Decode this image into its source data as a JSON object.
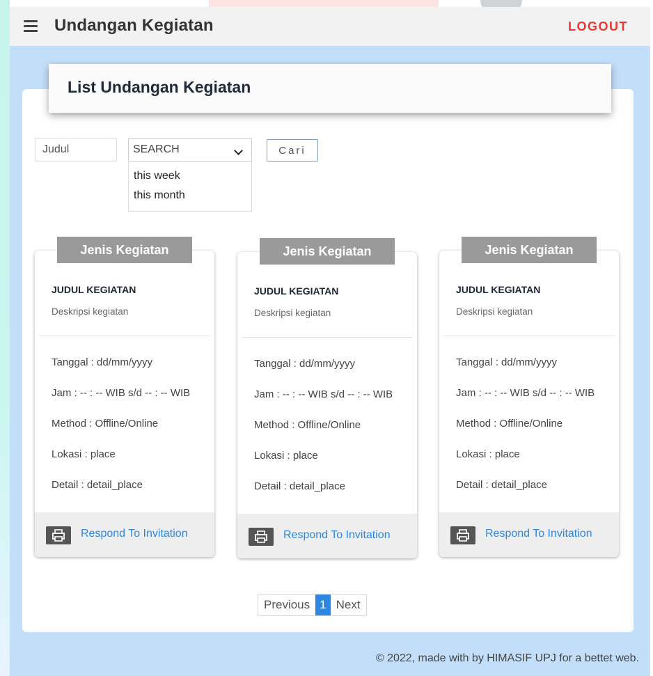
{
  "header": {
    "title": "Undangan Kegiatan",
    "logout_label": "LOGOUT"
  },
  "page": {
    "heading": "List Undangan Kegiatan"
  },
  "filters": {
    "judul_value": "Judul",
    "select_value": "SEARCH",
    "options": [
      "this week",
      "this month"
    ],
    "search_button": "Cari"
  },
  "cards": [
    {
      "tag": "Jenis Kegiatan",
      "title": "JUDUL KEGIATAN",
      "description": "Deskripsi kegiatan",
      "tanggal": "Tanggal : dd/mm/yyyy",
      "jam": "Jam : -- : -- WIB s/d -- : -- WIB",
      "method": "Method : Offline/Online",
      "lokasi": "Lokasi : place",
      "detail": "Detail : detail_place",
      "action": "Respond To Invitation"
    },
    {
      "tag": "Jenis Kegiatan",
      "title": "JUDUL KEGIATAN",
      "description": "Deskripsi kegiatan",
      "tanggal": "Tanggal : dd/mm/yyyy",
      "jam": "Jam : -- : -- WIB s/d -- : -- WIB",
      "method": "Method : Offline/Online",
      "lokasi": "Lokasi : place",
      "detail": "Detail : detail_place",
      "action": "Respond To Invitation"
    },
    {
      "tag": "Jenis Kegiatan",
      "title": "JUDUL KEGIATAN",
      "description": "Deskripsi kegiatan",
      "tanggal": "Tanggal : dd/mm/yyyy",
      "jam": "Jam : -- : -- WIB s/d -- : -- WIB",
      "method": "Method : Offline/Online",
      "lokasi": "Lokasi : place",
      "detail": "Detail : detail_place",
      "action": "Respond To Invitation"
    }
  ],
  "pagination": {
    "previous": "Previous",
    "current": "1",
    "next": "Next"
  },
  "footer": {
    "text": "© 2022, made with by HIMASIF UPJ for a bettet web."
  },
  "colors": {
    "page_bg": "#c3def9",
    "logout": "#e53935",
    "link": "#2e86de",
    "tag_bg": "#9a9a9a"
  }
}
